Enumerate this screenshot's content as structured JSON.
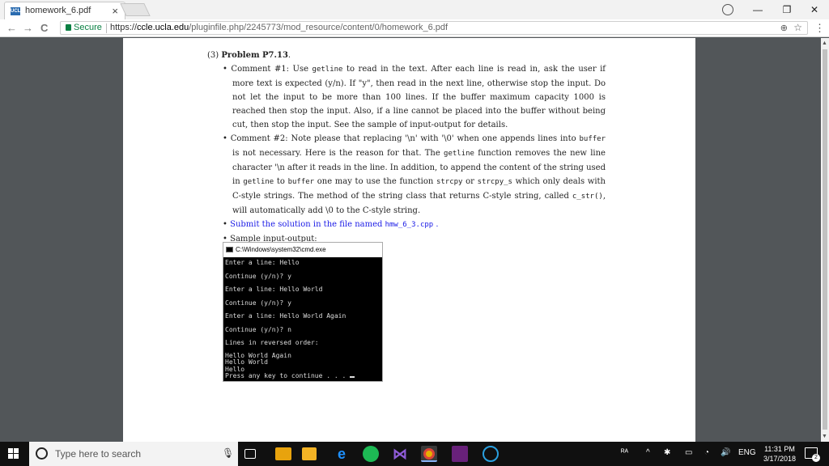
{
  "browser": {
    "tab_title": "homework_6.pdf",
    "tab_close": "×",
    "favicon_text": "UCLA",
    "secure_label": "Secure",
    "url_scheme": "https://",
    "url_domain": "ccle.ucla.edu",
    "url_path": "/pluginfile.php/2245773/mod_resource/content/0/homework_6.pdf",
    "win_minimize": "—",
    "win_restore": "❐",
    "win_close": "✕",
    "back_glyph": "←",
    "forward_glyph": "→",
    "reload_glyph": "C",
    "zoom_glyph": "⊕",
    "star_glyph": "☆",
    "menu_glyph": "⋮"
  },
  "doc": {
    "problem_number": "(3)",
    "problem_title": "Problem P7.13",
    "problem_period": ".",
    "bullet1": "Comment #1: Use ",
    "bullet1_code1": "getline",
    "bullet1_rest": " to read in the text. After each line is read in, ask the user if more text is expected (y/n). If \"y\", then read in the next line, otherwise stop the input. Do not let the input to be more than 100 lines. If the buffer maximum capacity 1000 is reached then stop the input. Also, if a line cannot be placed into the buffer without being cut, then stop the input. See the sample of input-output for details.",
    "bullet2_a": "Comment #2: Note please that replacing '\\n' with '\\0' when one appends lines into ",
    "bullet2_code1": "buffer",
    "bullet2_b": " is not necessary. Here is the reason for that. The ",
    "bullet2_code2": "getline",
    "bullet2_c": " function removes the new line character '\\n after it reads in the line. In addition, to append the content of the string used in ",
    "bullet2_code3": "getline",
    "bullet2_d": " to ",
    "bullet2_code4": "buffer",
    "bullet2_e": " one may to use the function ",
    "bullet2_code5": "strcpy",
    "bullet2_f": " or ",
    "bullet2_code6": "strcpy_s",
    "bullet2_g": " which only deals with C-style strings. The method of the string class that returns C-style string, called ",
    "bullet2_code7": "c_str()",
    "bullet2_h": ", will automatically add \\0 to the C-style string.",
    "bullet3_a": "Submit the solution in the file named ",
    "bullet3_code": "hmw_6_3.cpp",
    "bullet3_b": " .",
    "bullet4": "Sample input-output:",
    "bullet_dot": "•"
  },
  "cmd": {
    "title": "C:\\Windows\\system32\\cmd.exe",
    "lines": [
      "Enter a line: Hello",
      "Continue (y/n)? y",
      "Enter a line: Hello World",
      "Continue (y/n)? y",
      "Enter a line: Hello World Again",
      "Continue (y/n)? n",
      "Lines in reversed order:"
    ],
    "output_lines": [
      "Hello World Again",
      "Hello World",
      "Hello"
    ],
    "prompt_line": "Press any key to continue . . . "
  },
  "taskbar": {
    "search_placeholder": "Type here to search",
    "mic_glyph": "🎙",
    "tray_people": "ᴿᴬ",
    "tray_chevron": "^",
    "tray_lang": "ENG",
    "tray_volume": "🔊",
    "tray_wifi": "◔",
    "tray_battery": "▭",
    "tray_bt": "✱",
    "time": "11:31 PM",
    "date": "3/17/2018",
    "notif_count": "2"
  }
}
